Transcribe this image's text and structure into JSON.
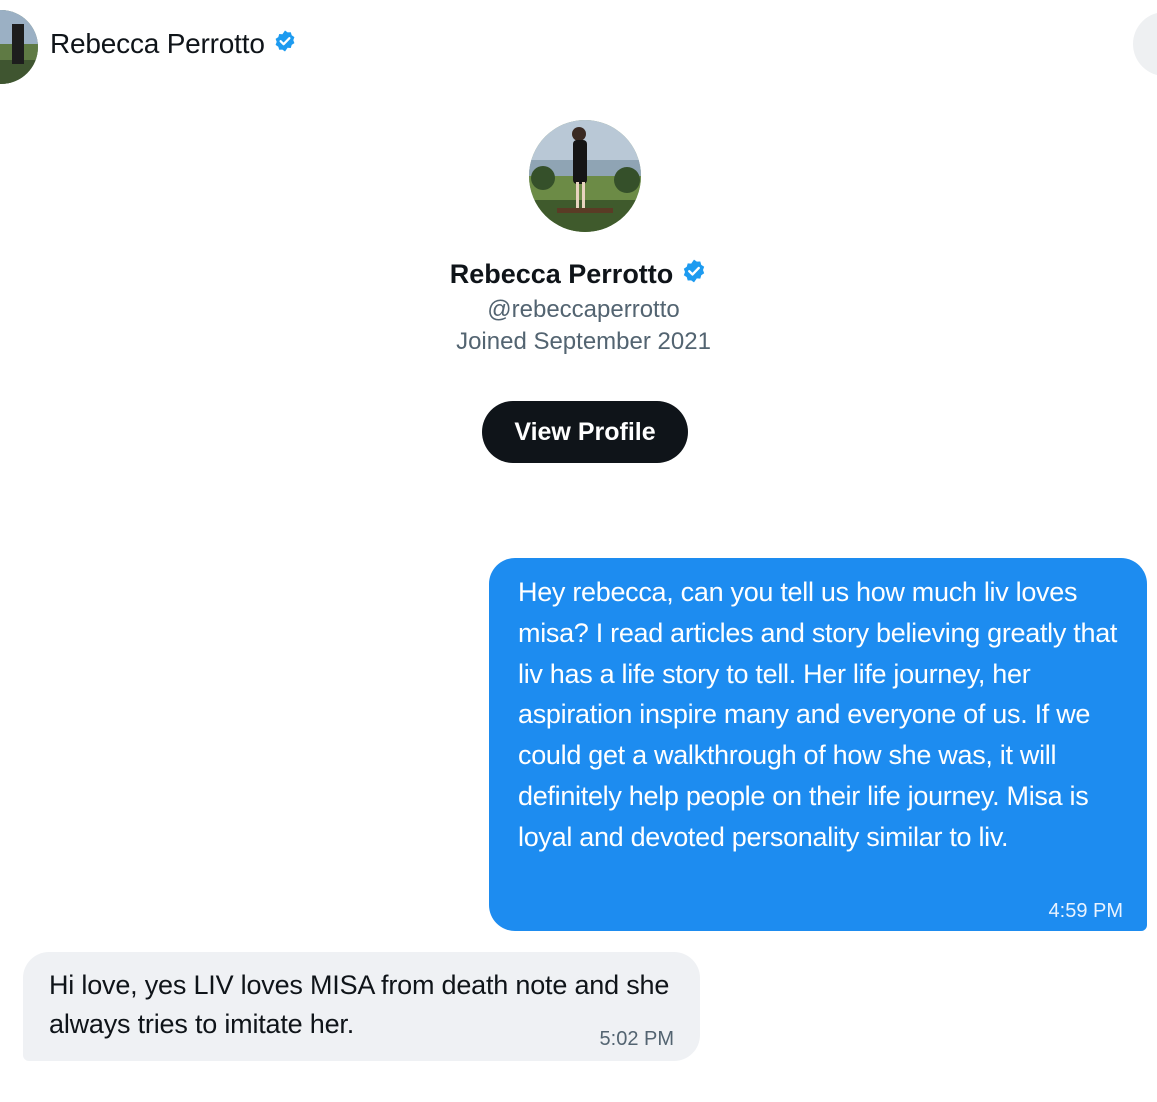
{
  "header": {
    "name": "Rebecca Perrotto",
    "verified_icon": "verified-badge-icon"
  },
  "profile": {
    "name": "Rebecca Perrotto",
    "handle": "@rebeccaperrotto",
    "joined": "Joined September 2021",
    "view_profile_label": "View Profile"
  },
  "messages": [
    {
      "direction": "sent",
      "text": "Hey rebecca, can you tell us how much liv loves misa? I read articles and story believing greatly that liv has a life story to tell. Her life journey, her aspiration inspire many and everyone of us. If we could get a walkthrough of how she was, it will definitely help people on their life journey. Misa is loyal and devoted personality similar to liv.",
      "time": "4:59 PM"
    },
    {
      "direction": "received",
      "text": "Hi love, yes LIV loves MISA from death note and she always tries to imitate her.",
      "time": "5:02 PM"
    }
  ],
  "colors": {
    "sent_bubble": "#1d8cf0",
    "received_bubble": "#eff1f4",
    "verified": "#1d9bf0",
    "button": "#0f1419"
  }
}
